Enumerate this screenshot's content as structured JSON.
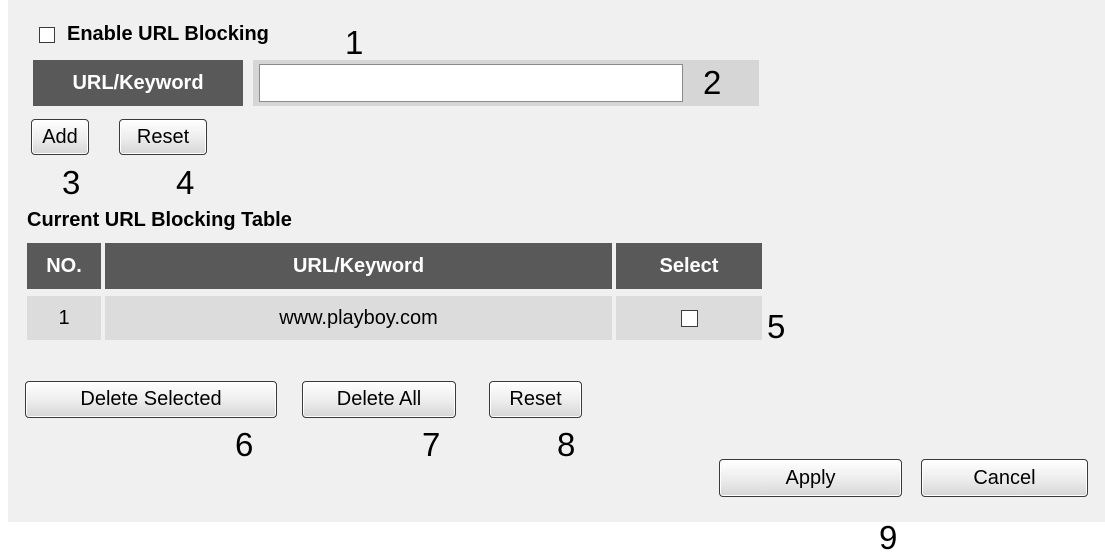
{
  "settings": {
    "enable_label": "Enable URL Blocking",
    "url_keyword_label": "URL/Keyword",
    "url_input_value": "",
    "add_label": "Add",
    "reset_label": "Reset"
  },
  "table": {
    "title": "Current URL Blocking Table",
    "columns": [
      "NO.",
      "URL/Keyword",
      "Select"
    ],
    "rows": [
      {
        "no": "1",
        "url": "www.playboy.com",
        "selected": false
      }
    ]
  },
  "actions": {
    "delete_selected": "Delete Selected",
    "delete_all": "Delete All",
    "reset": "Reset"
  },
  "footer": {
    "apply": "Apply",
    "cancel": "Cancel"
  },
  "annotations": [
    "1",
    "2",
    "3",
    "4",
    "5",
    "6",
    "7",
    "8",
    "9"
  ]
}
